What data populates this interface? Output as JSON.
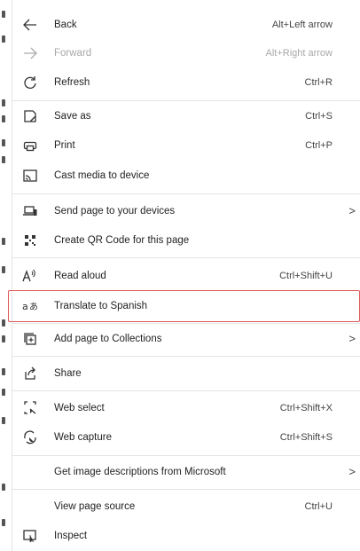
{
  "cursor_glyph": "k",
  "menu": {
    "items": [
      {
        "label": "Back",
        "shortcut": "Alt+Left arrow",
        "icon": "arrow-left-icon"
      },
      {
        "label": "Forward",
        "shortcut": "Alt+Right arrow",
        "icon": "arrow-right-icon",
        "disabled": true
      },
      {
        "label": "Refresh",
        "shortcut": "Ctrl+R",
        "icon": "refresh-icon"
      },
      {
        "label": "Save as",
        "shortcut": "Ctrl+S",
        "icon": "save-as-icon"
      },
      {
        "label": "Print",
        "shortcut": "Ctrl+P",
        "icon": "print-icon"
      },
      {
        "label": "Cast media to device",
        "shortcut": "",
        "icon": "cast-icon"
      },
      {
        "label": "Send page to your devices",
        "shortcut": "",
        "icon": "send-to-devices-icon",
        "submenu": true
      },
      {
        "label": "Create QR Code for this page",
        "shortcut": "",
        "icon": "qr-code-icon"
      },
      {
        "label": "Read aloud",
        "shortcut": "Ctrl+Shift+U",
        "icon": "read-aloud-icon"
      },
      {
        "label": "Translate to Spanish",
        "shortcut": "",
        "icon": "translate-icon",
        "highlighted": true
      },
      {
        "label": "Add page to Collections",
        "shortcut": "",
        "icon": "collections-icon",
        "submenu": true
      },
      {
        "label": "Share",
        "shortcut": "",
        "icon": "share-icon"
      },
      {
        "label": "Web select",
        "shortcut": "Ctrl+Shift+X",
        "icon": "web-select-icon"
      },
      {
        "label": "Web capture",
        "shortcut": "Ctrl+Shift+S",
        "icon": "web-capture-icon"
      },
      {
        "label": "Get image descriptions from Microsoft",
        "shortcut": "",
        "icon": "",
        "submenu": true
      },
      {
        "label": "View page source",
        "shortcut": "Ctrl+U",
        "icon": ""
      },
      {
        "label": "Inspect",
        "shortcut": "",
        "icon": "inspect-icon"
      }
    ],
    "chevron": ">"
  },
  "colors": {
    "highlight_border": "#e05a5a",
    "disabled_text": "#a8a8a8"
  }
}
